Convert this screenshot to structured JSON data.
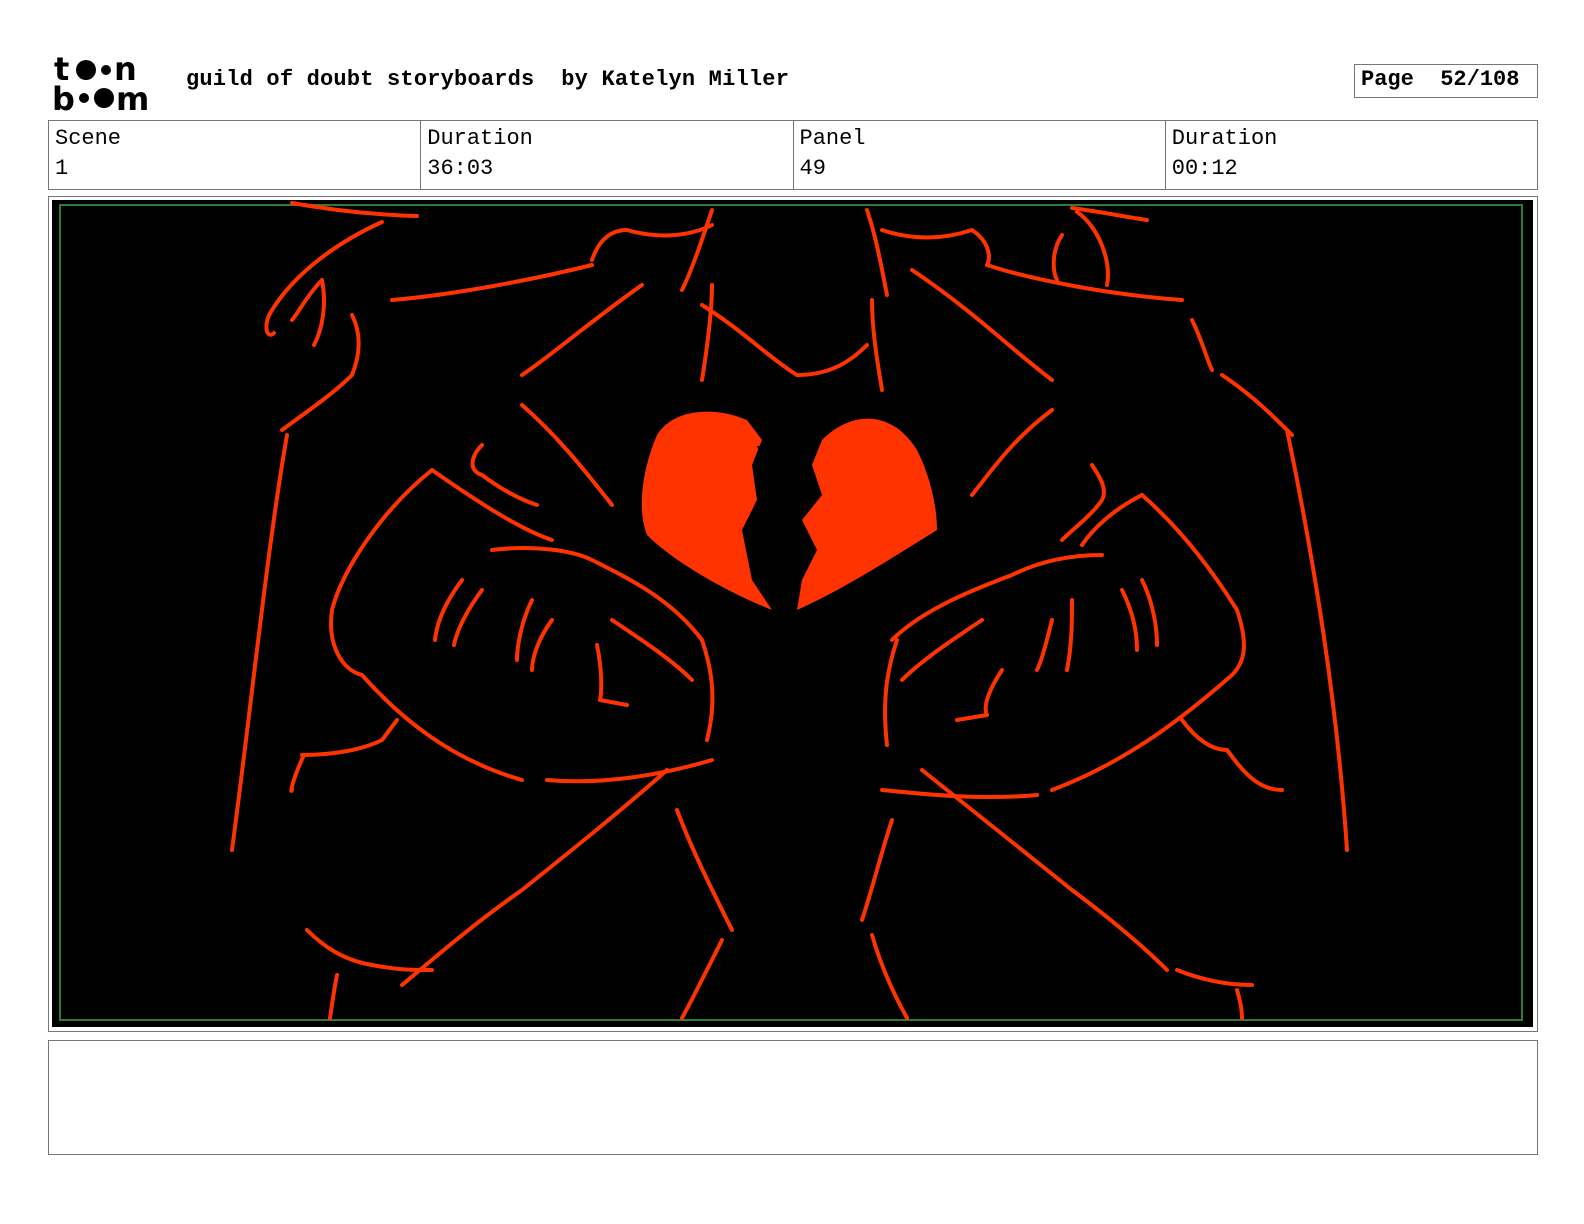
{
  "header": {
    "logo_top": "t●●n",
    "logo_bottom": "b●●m",
    "title": "guild of doubt storyboards  by Katelyn Miller",
    "page_label": "Page  52/108"
  },
  "info": [
    {
      "label": "Scene",
      "value": "1"
    },
    {
      "label": "Duration",
      "value": "36:03"
    },
    {
      "label": "Panel",
      "value": "49"
    },
    {
      "label": "Duration",
      "value": "00:12"
    }
  ],
  "panel": {
    "background_color": "#000000",
    "line_color": "#ff3300",
    "safe_frame_color": "#2e7d32"
  },
  "notes": {
    "text": ""
  }
}
